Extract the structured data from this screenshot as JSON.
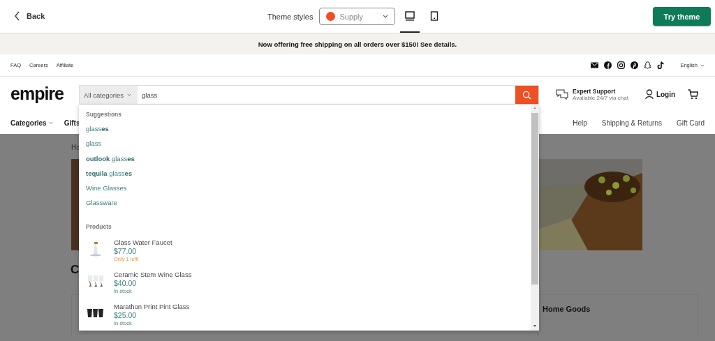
{
  "top_bar": {
    "back": "Back",
    "theme_label": "Theme styles",
    "theme_select": {
      "value": "Supply",
      "color": "#f04e23"
    },
    "devices": [
      {
        "kind": "desktop",
        "selected": true
      },
      {
        "kind": "mobile",
        "selected": false
      }
    ],
    "try_button": "Try theme"
  },
  "announcement": "Now offering free shipping on all orders over $150! See details.",
  "utility_links": [
    "FAQ",
    "Careers",
    "Affiliate"
  ],
  "social": [
    {
      "kind": "mail"
    },
    {
      "kind": "facebook"
    },
    {
      "kind": "instagram"
    },
    {
      "kind": "pinterest"
    },
    {
      "kind": "snapchat"
    },
    {
      "kind": "tiktok"
    }
  ],
  "language": "English",
  "header": {
    "logo": "empire",
    "category_select": "All categories",
    "search_value": "glass",
    "support_title": "Expert Support",
    "support_subtitle": "Available 24/7 via chat",
    "login": "Login"
  },
  "nav_left": [
    "Categories",
    "Gifts"
  ],
  "nav_right": [
    "Help",
    "Shipping & Returns",
    "Gift Card"
  ],
  "search_dropdown": {
    "suggestions_title": "Suggestions",
    "suggestions": [
      "glass**es**",
      "glass",
      "**outlook** glass**es**",
      "**tequila** glass**es**",
      "Wine Glasses",
      "Glassware"
    ],
    "products_title": "Products",
    "products": [
      {
        "kind": "faucet",
        "name": "Glass Water Faucet",
        "price": "$77.00",
        "stock": {
          "text": "Only 1 left!",
          "kind": "low"
        }
      },
      {
        "kind": "wine",
        "name": "Ceramic Stem Wine Glass",
        "price": "$40.00",
        "stock": {
          "text": "In stock",
          "kind": "in_stock"
        }
      },
      {
        "kind": "pint",
        "name": "Marathon Print Pint Glass",
        "price": "$25.00",
        "stock": {
          "text": "In stock",
          "kind": "in_stock"
        }
      }
    ]
  },
  "page": {
    "breadcrumb": "Ho",
    "heading": "C",
    "card_title": "Home Goods"
  }
}
